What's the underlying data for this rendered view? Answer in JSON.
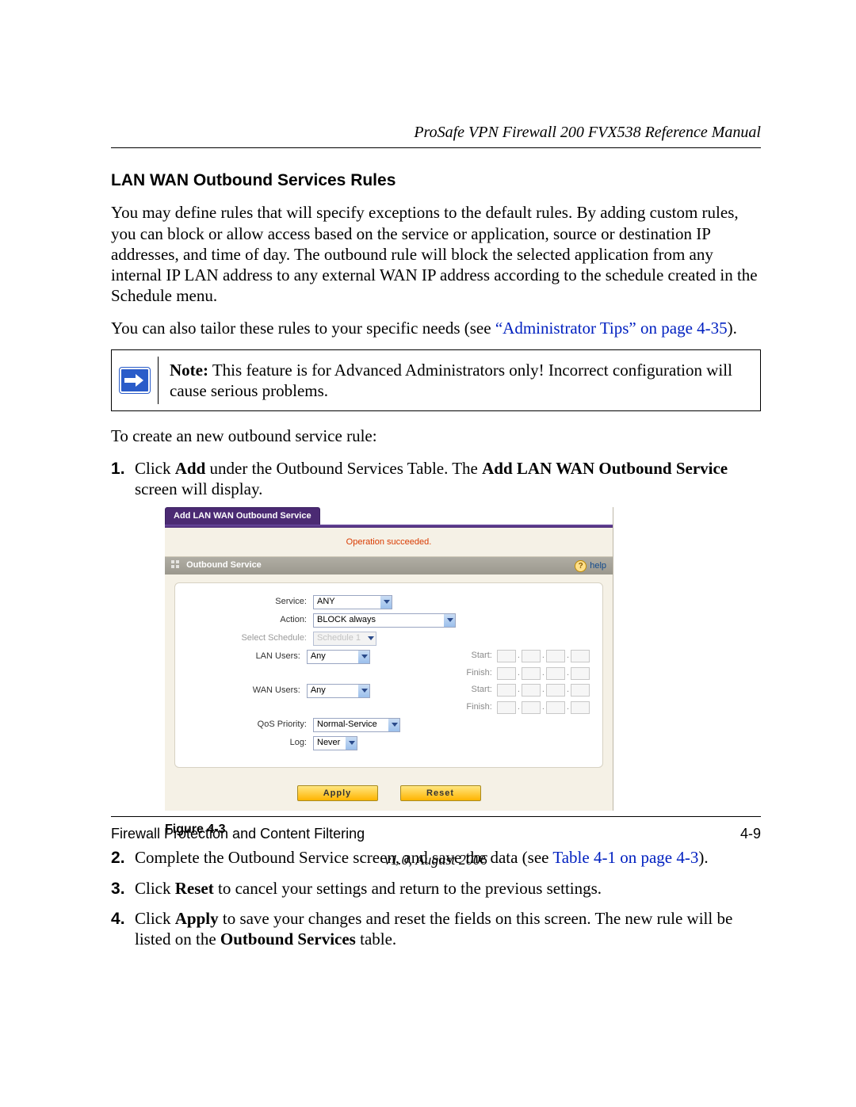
{
  "header": {
    "doc_title": "ProSafe VPN Firewall 200 FVX538 Reference Manual"
  },
  "section_title": "LAN WAN Outbound Services Rules",
  "paragraphs": {
    "p1": "You may define rules that will specify exceptions to the default rules. By adding custom rules, you can block or allow access based on the service or application, source or destination IP addresses, and time of day. The outbound rule will block the selected application from any internal IP LAN address to any external WAN IP address according to the schedule created in the Schedule menu.",
    "p2a": "You can also tailor these rules to your specific needs (see ",
    "p2_link": "“Administrator Tips” on page 4-35",
    "p2b": ").",
    "note_label": "Note:",
    "note_text": " This feature is for Advanced Administrators only! Incorrect configuration will cause serious problems.",
    "lead": "To create an new outbound service rule:"
  },
  "steps": {
    "s1a": "Click ",
    "s1b": "Add",
    "s1c": " under the Outbound Services Table. The ",
    "s1d": "Add LAN WAN Outbound Service",
    "s1e": " screen will display.",
    "s2a": "Complete the Outbound Service screen, and save the data (see ",
    "s2_link": "Table 4-1 on page 4-3",
    "s2b": ").",
    "s3a": "Click ",
    "s3b": "Reset",
    "s3c": " to cancel your settings and return to the previous settings.",
    "s4a": "Click ",
    "s4b": "Apply",
    "s4c": " to save your changes and reset the fields on this screen. The new rule will be listed on the ",
    "s4d": "Outbound Services",
    "s4e": " table."
  },
  "figure": {
    "tab_title": "Add LAN WAN Outbound Service",
    "op_msg": "Operation succeeded.",
    "section_label": "Outbound Service",
    "help": "help",
    "labels": {
      "service": "Service:",
      "action": "Action:",
      "schedule": "Select Schedule:",
      "lan": "LAN Users:",
      "wan": "WAN Users:",
      "qos": "QoS Priority:",
      "log": "Log:",
      "start": "Start:",
      "finish": "Finish:"
    },
    "values": {
      "service": "ANY",
      "action": "BLOCK always",
      "schedule": "Schedule 1",
      "lan": "Any",
      "wan": "Any",
      "qos": "Normal-Service",
      "log": "Never"
    },
    "buttons": {
      "apply": "Apply",
      "reset": "Reset"
    },
    "caption": "Figure 4-3"
  },
  "footer": {
    "left": "Firewall Protection and Content Filtering",
    "right": "4-9",
    "version": "v1.0, August 2006"
  }
}
